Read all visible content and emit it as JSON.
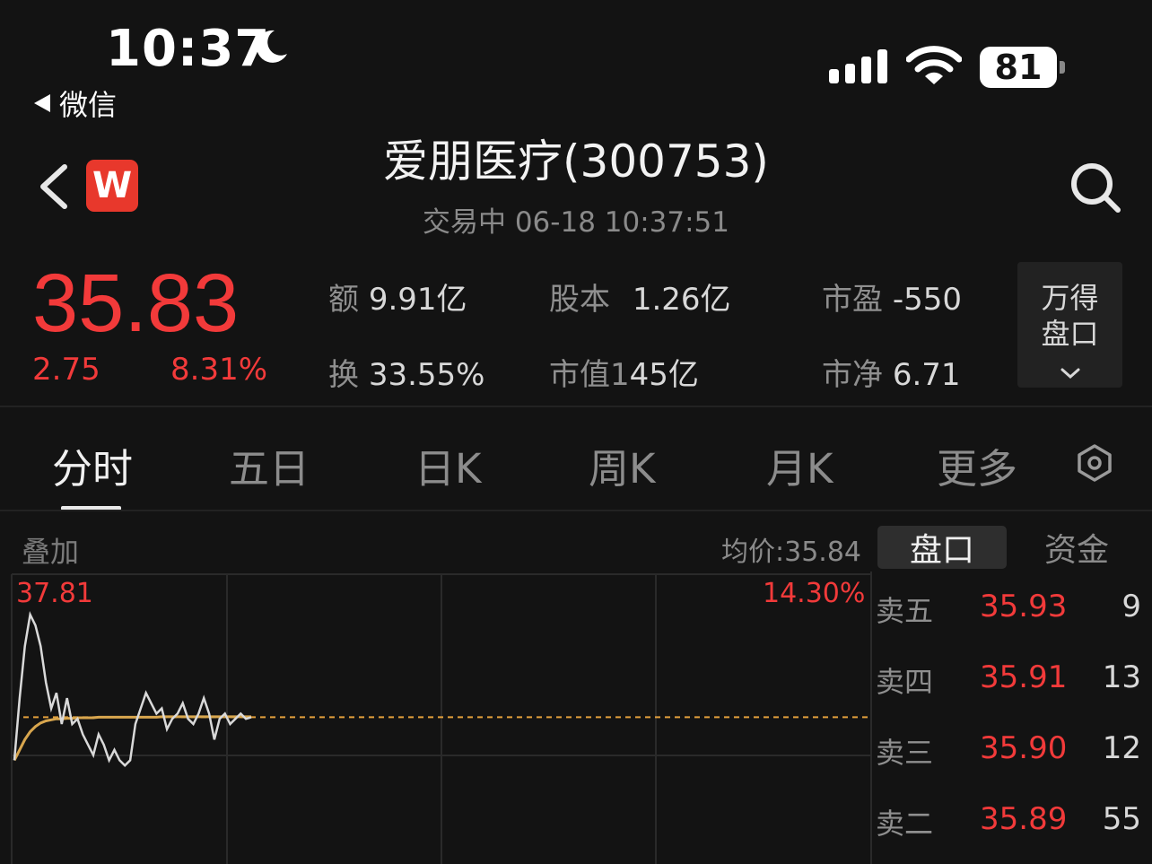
{
  "status_bar": {
    "time": "10:37",
    "back_app": "微信",
    "battery": "81"
  },
  "nav": {
    "logo_letter": "W",
    "title": "爱朋医疗(300753)",
    "subtitle": "交易中  06-18 10:37:51"
  },
  "quote": {
    "price": "35.83",
    "change": "2.75",
    "change_pct": "8.31%",
    "price_color": "#f23a3a",
    "stats": [
      {
        "label": "额",
        "value": "9.91亿"
      },
      {
        "label": "股本",
        "value": "1.26亿"
      },
      {
        "label": "市盈",
        "value": "-550"
      },
      {
        "label": "换",
        "value": "33.55%"
      },
      {
        "label": "市值1",
        "value": "45亿"
      },
      {
        "label": "市净",
        "value": "6.71"
      }
    ],
    "wind_panel": [
      "万得",
      "盘口"
    ]
  },
  "tabs": [
    "分时",
    "五日",
    "日K",
    "周K",
    "月K",
    "更多"
  ],
  "chart_header": {
    "overlay": "叠加",
    "avg_price": "均价:35.84",
    "high_price": "37.81",
    "high_pct": "14.30%"
  },
  "chart_data": {
    "type": "line",
    "series": [
      {
        "name": "price",
        "values": [
          35.0,
          36.2,
          37.2,
          37.81,
          37.6,
          37.2,
          36.5,
          36.0,
          36.3,
          35.7,
          36.2,
          35.7,
          35.8,
          35.5,
          35.3,
          35.1,
          35.5,
          35.3,
          35.0,
          35.2,
          35.0,
          34.9,
          35.0,
          35.7,
          36.0,
          36.3,
          36.1,
          35.9,
          36.0,
          35.6,
          35.8,
          35.9,
          36.1,
          35.8,
          35.7,
          35.9,
          36.2,
          35.9,
          35.4,
          35.8,
          35.9,
          35.7,
          35.8,
          35.9,
          35.8,
          35.83
        ]
      },
      {
        "name": "avg",
        "values": [
          35.0,
          35.2,
          35.4,
          35.55,
          35.65,
          35.72,
          35.76,
          35.78,
          35.8,
          35.8,
          35.81,
          35.81,
          35.82,
          35.82,
          35.82,
          35.82,
          35.83,
          35.83,
          35.83,
          35.83,
          35.83,
          35.83,
          35.83,
          35.83,
          35.83,
          35.83,
          35.83,
          35.83,
          35.84,
          35.84,
          35.84,
          35.84,
          35.84,
          35.84,
          35.84,
          35.84,
          35.84,
          35.84,
          35.84,
          35.84,
          35.84,
          35.84,
          35.84,
          35.84,
          35.84,
          35.84
        ]
      }
    ],
    "ylim": [
      33.0,
      37.81
    ],
    "reference": 35.83
  },
  "order_book": {
    "tabs": [
      "盘口",
      "资金"
    ],
    "rows": [
      {
        "label": "卖五",
        "price": "35.93",
        "volume": "9"
      },
      {
        "label": "卖四",
        "price": "35.91",
        "volume": "13"
      },
      {
        "label": "卖三",
        "price": "35.90",
        "volume": "12"
      },
      {
        "label": "卖二",
        "price": "35.89",
        "volume": "55"
      }
    ]
  }
}
